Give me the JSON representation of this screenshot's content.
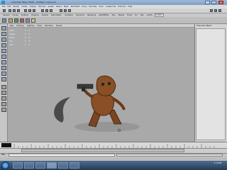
{
  "window": {
    "title": "Autodesk Maya 2008 - Untitled: scene.ma",
    "min_label": "_",
    "max_label": "□",
    "close_label": "X"
  },
  "menubar": {
    "items": [
      "File",
      "Edit",
      "Modify",
      "Create",
      "Display",
      "Window",
      "Assets",
      "Select",
      "Mesh",
      "Edit Mesh",
      "Proxy",
      "Normals",
      "Color",
      "Create UVs",
      "Edit UVs",
      "Help"
    ]
  },
  "shelf": {
    "tabs": [
      "General",
      "Curves",
      "Surfaces",
      "Polygons",
      "Subdivs",
      "Deformation",
      "Animation",
      "Dynamics",
      "Rendering",
      "PaintEffects",
      "Toon",
      "Muscle",
      "Fluids",
      "Fur",
      "Hair",
      "nCloth",
      "Custom"
    ],
    "active_tab": "Custom"
  },
  "panel_menu": {
    "items": [
      "View",
      "Shading",
      "Lighting",
      "Show",
      "Renderer",
      "Panels"
    ]
  },
  "hud": {
    "rows": [
      {
        "name": "Verts:",
        "a": "0",
        "b": "0"
      },
      {
        "name": "Edges:",
        "a": "0",
        "b": "0"
      },
      {
        "name": "Faces:",
        "a": "0",
        "b": "0"
      },
      {
        "name": "Tris:",
        "a": "0",
        "b": "0"
      },
      {
        "name": "UVs:",
        "a": "0",
        "b": "0"
      }
    ]
  },
  "channel_box": {
    "title": "Channels  Object"
  },
  "cmdline": {
    "label": "MEL"
  },
  "taskbar": {
    "clock": "2:14 PM"
  },
  "colors": {
    "viewport_bg": "#a9a9a9",
    "character_body": "#8a4f24",
    "title_bar": "#7f9fc4",
    "taskbar": "#233a55"
  }
}
